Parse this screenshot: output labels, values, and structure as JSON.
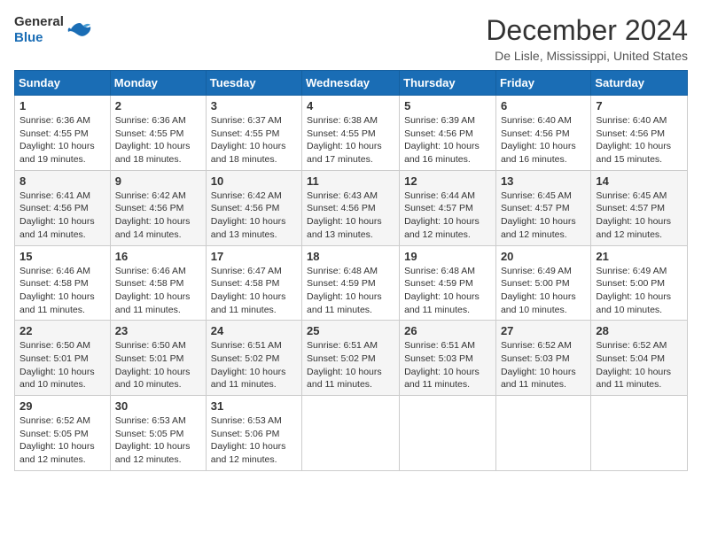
{
  "header": {
    "logo_general": "General",
    "logo_blue": "Blue",
    "title": "December 2024",
    "location": "De Lisle, Mississippi, United States"
  },
  "calendar": {
    "days_of_week": [
      "Sunday",
      "Monday",
      "Tuesday",
      "Wednesday",
      "Thursday",
      "Friday",
      "Saturday"
    ],
    "weeks": [
      [
        {
          "day": 1,
          "sunrise": "6:36 AM",
          "sunset": "4:55 PM",
          "daylight": "10 hours and 19 minutes."
        },
        {
          "day": 2,
          "sunrise": "6:36 AM",
          "sunset": "4:55 PM",
          "daylight": "10 hours and 18 minutes."
        },
        {
          "day": 3,
          "sunrise": "6:37 AM",
          "sunset": "4:55 PM",
          "daylight": "10 hours and 18 minutes."
        },
        {
          "day": 4,
          "sunrise": "6:38 AM",
          "sunset": "4:55 PM",
          "daylight": "10 hours and 17 minutes."
        },
        {
          "day": 5,
          "sunrise": "6:39 AM",
          "sunset": "4:56 PM",
          "daylight": "10 hours and 16 minutes."
        },
        {
          "day": 6,
          "sunrise": "6:40 AM",
          "sunset": "4:56 PM",
          "daylight": "10 hours and 16 minutes."
        },
        {
          "day": 7,
          "sunrise": "6:40 AM",
          "sunset": "4:56 PM",
          "daylight": "10 hours and 15 minutes."
        }
      ],
      [
        {
          "day": 8,
          "sunrise": "6:41 AM",
          "sunset": "4:56 PM",
          "daylight": "10 hours and 14 minutes."
        },
        {
          "day": 9,
          "sunrise": "6:42 AM",
          "sunset": "4:56 PM",
          "daylight": "10 hours and 14 minutes."
        },
        {
          "day": 10,
          "sunrise": "6:42 AM",
          "sunset": "4:56 PM",
          "daylight": "10 hours and 13 minutes."
        },
        {
          "day": 11,
          "sunrise": "6:43 AM",
          "sunset": "4:56 PM",
          "daylight": "10 hours and 13 minutes."
        },
        {
          "day": 12,
          "sunrise": "6:44 AM",
          "sunset": "4:57 PM",
          "daylight": "10 hours and 12 minutes."
        },
        {
          "day": 13,
          "sunrise": "6:45 AM",
          "sunset": "4:57 PM",
          "daylight": "10 hours and 12 minutes."
        },
        {
          "day": 14,
          "sunrise": "6:45 AM",
          "sunset": "4:57 PM",
          "daylight": "10 hours and 12 minutes."
        }
      ],
      [
        {
          "day": 15,
          "sunrise": "6:46 AM",
          "sunset": "4:58 PM",
          "daylight": "10 hours and 11 minutes."
        },
        {
          "day": 16,
          "sunrise": "6:46 AM",
          "sunset": "4:58 PM",
          "daylight": "10 hours and 11 minutes."
        },
        {
          "day": 17,
          "sunrise": "6:47 AM",
          "sunset": "4:58 PM",
          "daylight": "10 hours and 11 minutes."
        },
        {
          "day": 18,
          "sunrise": "6:48 AM",
          "sunset": "4:59 PM",
          "daylight": "10 hours and 11 minutes."
        },
        {
          "day": 19,
          "sunrise": "6:48 AM",
          "sunset": "4:59 PM",
          "daylight": "10 hours and 11 minutes."
        },
        {
          "day": 20,
          "sunrise": "6:49 AM",
          "sunset": "5:00 PM",
          "daylight": "10 hours and 10 minutes."
        },
        {
          "day": 21,
          "sunrise": "6:49 AM",
          "sunset": "5:00 PM",
          "daylight": "10 hours and 10 minutes."
        }
      ],
      [
        {
          "day": 22,
          "sunrise": "6:50 AM",
          "sunset": "5:01 PM",
          "daylight": "10 hours and 10 minutes."
        },
        {
          "day": 23,
          "sunrise": "6:50 AM",
          "sunset": "5:01 PM",
          "daylight": "10 hours and 10 minutes."
        },
        {
          "day": 24,
          "sunrise": "6:51 AM",
          "sunset": "5:02 PM",
          "daylight": "10 hours and 11 minutes."
        },
        {
          "day": 25,
          "sunrise": "6:51 AM",
          "sunset": "5:02 PM",
          "daylight": "10 hours and 11 minutes."
        },
        {
          "day": 26,
          "sunrise": "6:51 AM",
          "sunset": "5:03 PM",
          "daylight": "10 hours and 11 minutes."
        },
        {
          "day": 27,
          "sunrise": "6:52 AM",
          "sunset": "5:03 PM",
          "daylight": "10 hours and 11 minutes."
        },
        {
          "day": 28,
          "sunrise": "6:52 AM",
          "sunset": "5:04 PM",
          "daylight": "10 hours and 11 minutes."
        }
      ],
      [
        {
          "day": 29,
          "sunrise": "6:52 AM",
          "sunset": "5:05 PM",
          "daylight": "10 hours and 12 minutes."
        },
        {
          "day": 30,
          "sunrise": "6:53 AM",
          "sunset": "5:05 PM",
          "daylight": "10 hours and 12 minutes."
        },
        {
          "day": 31,
          "sunrise": "6:53 AM",
          "sunset": "5:06 PM",
          "daylight": "10 hours and 12 minutes."
        },
        null,
        null,
        null,
        null
      ]
    ]
  }
}
